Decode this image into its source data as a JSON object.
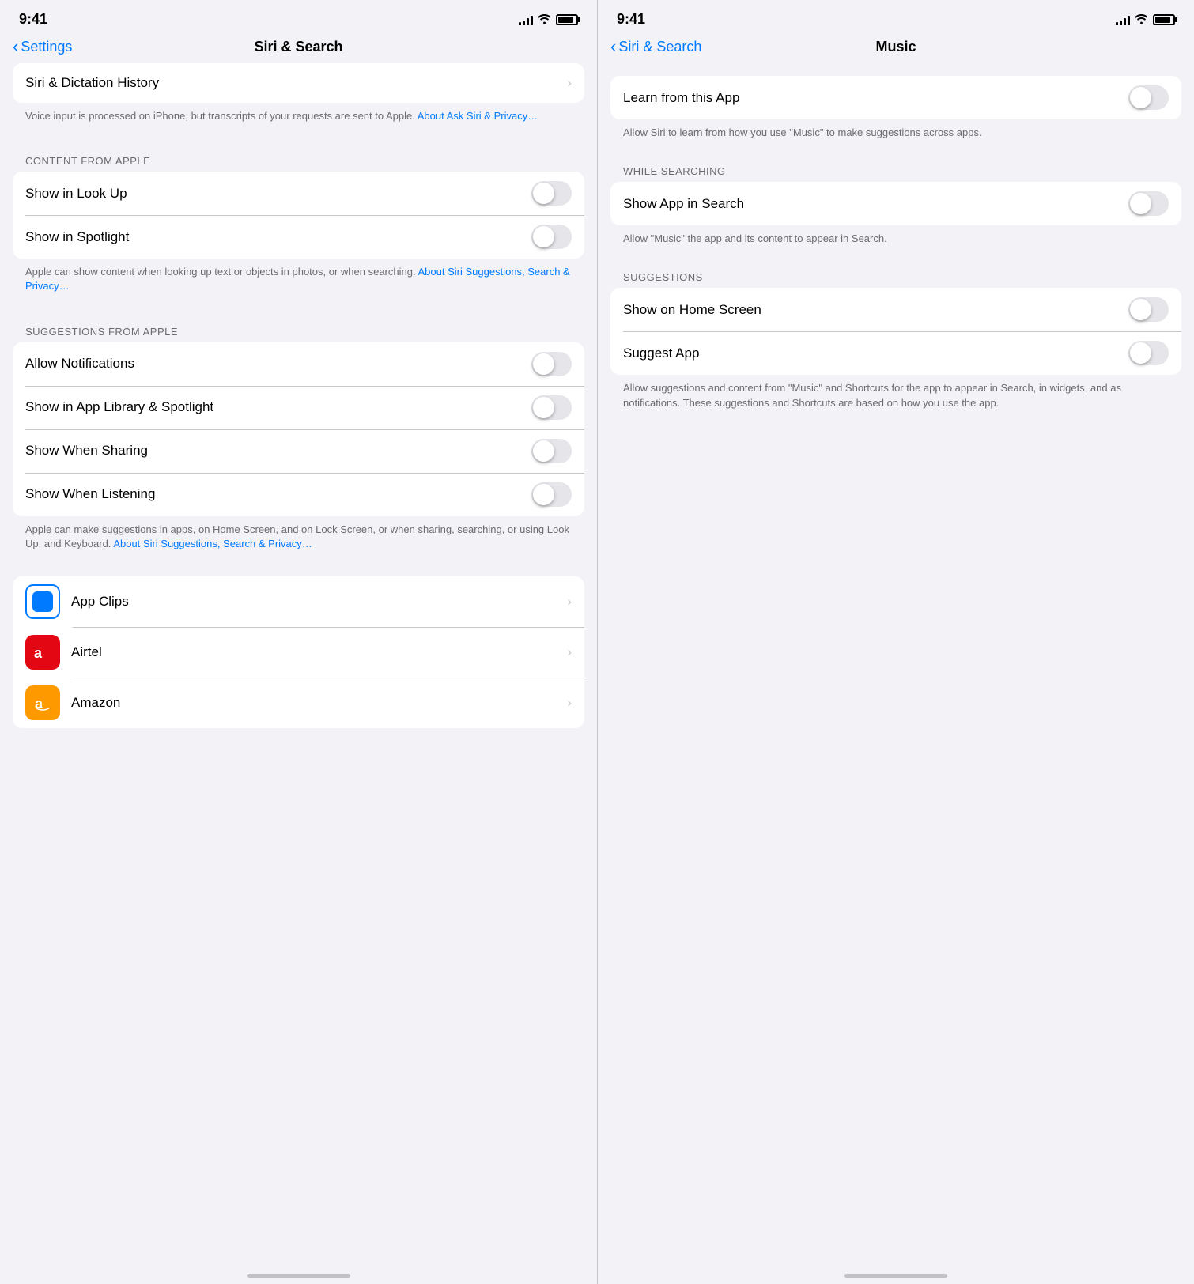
{
  "left": {
    "statusBar": {
      "time": "9:41",
      "signal": [
        4,
        6,
        8,
        10,
        12
      ],
      "wifi": true,
      "battery": true
    },
    "nav": {
      "backLabel": "Settings",
      "title": "Siri & Search"
    },
    "siriDictation": {
      "label": "Siri & Dictation History",
      "chevron": "›"
    },
    "siriDictationFooter": "Voice input is processed on iPhone, but transcripts of your requests are sent to Apple.",
    "siriDictationLink": "About Ask Siri & Privacy…",
    "contentFromApple": "CONTENT FROM APPLE",
    "lookUpLabel": "Show in Look Up",
    "spotlightLabel": "Show in Spotlight",
    "contentFooter": "Apple can show content when looking up text or objects in photos, or when searching.",
    "contentLink": "About Siri Suggestions, Search & Privacy…",
    "suggestionsFromApple": "SUGGESTIONS FROM APPLE",
    "allowNotificationsLabel": "Allow Notifications",
    "appLibraryLabel": "Show in App Library & Spotlight",
    "showWhenSharingLabel": "Show When Sharing",
    "showWhenListeningLabel": "Show When Listening",
    "suggestionsFooter": "Apple can make suggestions in apps, on Home Screen, and on Lock Screen, or when sharing, searching, or using Look Up, and Keyboard.",
    "suggestionsLink": "About Siri Suggestions, Search & Privacy…",
    "apps": [
      {
        "name": "App Clips",
        "type": "app-clips"
      },
      {
        "name": "Airtel",
        "type": "airtel"
      },
      {
        "name": "Amazon",
        "type": "amazon"
      }
    ]
  },
  "right": {
    "statusBar": {
      "time": "9:41"
    },
    "nav": {
      "backLabel": "Siri & Search",
      "title": "Music"
    },
    "learnFromApp": {
      "label": "Learn from this App",
      "desc": "Allow Siri to learn from how you use \"Music\" to make suggestions across apps."
    },
    "whileSearching": "WHILE SEARCHING",
    "showAppInSearch": {
      "label": "Show App in Search",
      "desc": "Allow \"Music\" the app and its content to appear in Search."
    },
    "suggestions": "SUGGESTIONS",
    "showOnHomeScreen": {
      "label": "Show on Home Screen"
    },
    "suggestApp": {
      "label": "Suggest App"
    },
    "suggestionsFooter": "Allow suggestions and content from \"Music\" and Shortcuts for the app to appear in Search, in widgets, and as notifications. These suggestions and Shortcuts are based on how you use the app."
  }
}
